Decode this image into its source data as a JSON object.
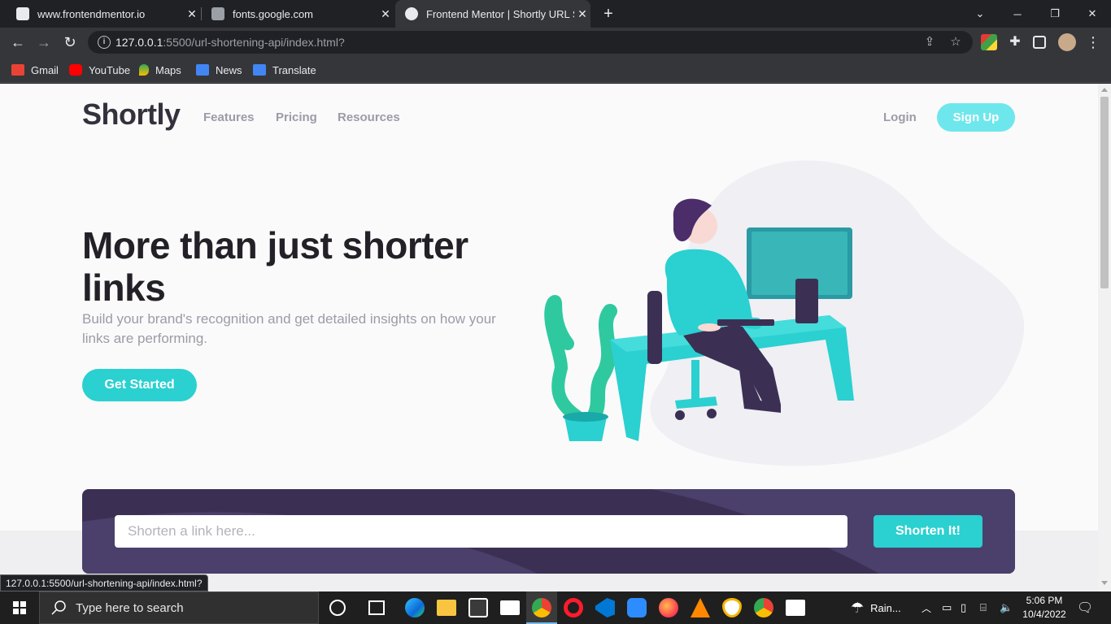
{
  "browser": {
    "tabs": [
      {
        "title": "www.frontendmentor.io",
        "active": false
      },
      {
        "title": "fonts.google.com",
        "active": false
      },
      {
        "title": "Frontend Mentor | Shortly URL Sh",
        "active": true
      }
    ],
    "url_host": "127.0.0.1",
    "url_rest": ":5500/url-shortening-api/index.html?",
    "bookmarks": [
      "Gmail",
      "YouTube",
      "Maps",
      "News",
      "Translate"
    ],
    "status_url": "127.0.0.1:5500/url-shortening-api/index.html?"
  },
  "page": {
    "logo": "Shortly",
    "nav": [
      "Features",
      "Pricing",
      "Resources"
    ],
    "login": "Login",
    "signup": "Sign Up",
    "hero_title": "More than just shorter links",
    "hero_subtitle": "Build your brand's recognition and get detailed insights on how your links are performing.",
    "cta": "Get Started",
    "shorten_placeholder": "Shorten a link here...",
    "shorten_button": "Shorten It!"
  },
  "taskbar": {
    "search_placeholder": "Type here to search",
    "weather": "Rain...",
    "time": "5:06 PM",
    "date": "10/4/2022"
  },
  "colors": {
    "accent": "#2bd0d0",
    "dark_violet": "#3b3054",
    "text_dark": "#232127",
    "text_gray": "#9e9aa7"
  }
}
